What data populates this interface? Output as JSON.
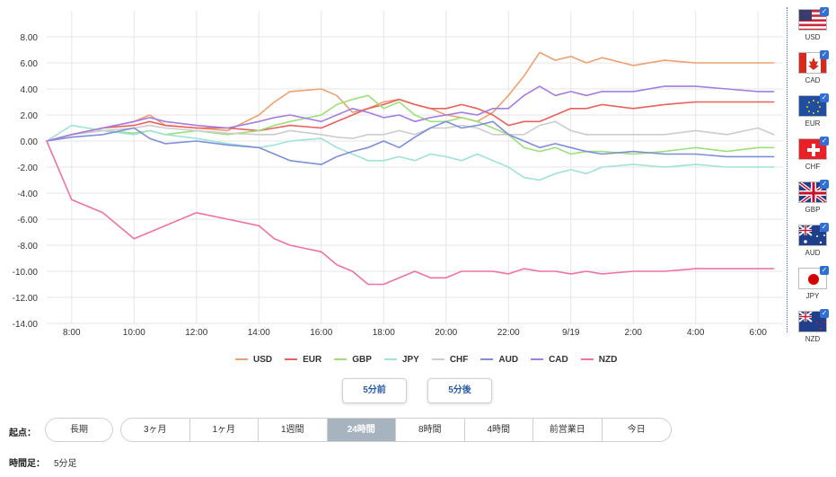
{
  "chart_data": {
    "type": "line",
    "ylim": [
      -14,
      10
    ],
    "yticks": [
      "8.00",
      "6.00",
      "4.00",
      "2.00",
      "0.00",
      "-2.00",
      "-4.00",
      "-6.00",
      "-8.00",
      "-10.00",
      "-12.00",
      "-14.00"
    ],
    "xticks": [
      "8:00",
      "10:00",
      "12:00",
      "14:00",
      "16:00",
      "18:00",
      "20:00",
      "22:00",
      "9/19",
      "2:00",
      "4:00",
      "6:00"
    ],
    "x_hours": [
      7.2,
      8,
      9,
      10,
      10.5,
      11,
      12,
      13,
      14,
      14.5,
      15,
      16,
      16.5,
      17,
      17.5,
      18,
      18.5,
      19,
      19.5,
      20,
      20.5,
      21,
      21.5,
      22,
      22.5,
      23,
      23.5,
      24,
      24.5,
      25,
      26,
      27,
      28,
      29,
      30,
      30.5
    ],
    "series": [
      {
        "name": "USD",
        "color": "#f0a070",
        "values": [
          0.0,
          0.5,
          1.0,
          1.5,
          2.0,
          1.2,
          1.0,
          0.8,
          2.0,
          3.0,
          3.8,
          4.0,
          3.5,
          2.2,
          2.5,
          3.0,
          3.2,
          2.8,
          2.5,
          2.0,
          1.8,
          1.5,
          2.2,
          3.5,
          5.0,
          6.8,
          6.2,
          6.5,
          6.0,
          6.4,
          5.8,
          6.2,
          6.0,
          6.0,
          6.0,
          6.0
        ]
      },
      {
        "name": "EUR",
        "color": "#e8615a",
        "values": [
          0.0,
          0.5,
          1.0,
          1.2,
          1.5,
          1.2,
          1.0,
          1.0,
          0.8,
          1.0,
          1.2,
          1.0,
          1.5,
          2.0,
          2.5,
          2.8,
          3.2,
          2.8,
          2.5,
          2.5,
          2.8,
          2.5,
          2.0,
          1.2,
          1.5,
          1.5,
          2.0,
          2.5,
          2.5,
          2.8,
          2.5,
          2.8,
          3.0,
          3.0,
          3.0,
          3.0
        ]
      },
      {
        "name": "GBP",
        "color": "#9be07a",
        "values": [
          0.0,
          0.5,
          0.8,
          0.6,
          0.8,
          0.5,
          0.8,
          0.5,
          0.8,
          1.2,
          1.5,
          2.0,
          2.8,
          3.2,
          3.5,
          2.5,
          3.0,
          2.0,
          1.5,
          1.5,
          1.8,
          1.5,
          1.0,
          0.5,
          -0.5,
          -0.8,
          -0.5,
          -1.0,
          -0.8,
          -0.8,
          -1.0,
          -0.8,
          -0.5,
          -0.8,
          -0.5,
          -0.5
        ]
      },
      {
        "name": "JPY",
        "color": "#9ee3d6",
        "values": [
          0.0,
          1.2,
          0.8,
          0.5,
          0.8,
          0.5,
          0.2,
          -0.2,
          -0.5,
          -0.3,
          0.0,
          0.2,
          -0.5,
          -1.0,
          -1.5,
          -1.5,
          -1.2,
          -1.5,
          -1.0,
          -1.2,
          -1.5,
          -1.0,
          -1.5,
          -2.0,
          -2.8,
          -3.0,
          -2.5,
          -2.2,
          -2.5,
          -2.0,
          -1.8,
          -2.0,
          -1.8,
          -2.0,
          -2.0,
          -2.0
        ]
      },
      {
        "name": "CHF",
        "color": "#cccccc",
        "values": [
          0.0,
          0.5,
          0.8,
          1.0,
          1.2,
          1.0,
          0.8,
          0.6,
          0.5,
          0.5,
          0.8,
          0.5,
          0.3,
          0.2,
          0.5,
          0.5,
          0.8,
          0.5,
          1.0,
          1.0,
          1.2,
          1.0,
          0.5,
          0.5,
          0.5,
          1.2,
          1.5,
          0.8,
          0.5,
          0.5,
          0.5,
          0.5,
          0.8,
          0.5,
          1.0,
          0.5
        ]
      },
      {
        "name": "AUD",
        "color": "#7f8ed9",
        "values": [
          0.0,
          0.3,
          0.5,
          1.0,
          0.2,
          -0.2,
          0.0,
          -0.3,
          -0.5,
          -1.0,
          -1.5,
          -1.8,
          -1.2,
          -0.8,
          -0.5,
          0.0,
          -0.5,
          0.3,
          1.0,
          1.5,
          1.0,
          1.2,
          1.5,
          0.5,
          0.0,
          -0.5,
          -0.2,
          -0.5,
          -0.8,
          -1.0,
          -0.8,
          -1.0,
          -1.0,
          -1.2,
          -1.2,
          -1.2
        ]
      },
      {
        "name": "CAD",
        "color": "#a57ce0",
        "values": [
          0.0,
          0.5,
          1.0,
          1.5,
          1.8,
          1.5,
          1.2,
          1.0,
          1.5,
          1.8,
          2.0,
          1.5,
          2.0,
          2.5,
          2.2,
          1.8,
          2.0,
          1.5,
          1.8,
          2.0,
          2.2,
          2.0,
          2.5,
          2.5,
          3.5,
          4.2,
          3.5,
          3.8,
          3.5,
          3.8,
          3.8,
          4.2,
          4.2,
          4.0,
          3.8,
          3.8
        ]
      },
      {
        "name": "NZD",
        "color": "#ee72a5",
        "values": [
          0.0,
          -4.5,
          -5.5,
          -7.5,
          -7.0,
          -6.5,
          -5.5,
          -6.0,
          -6.5,
          -7.5,
          -8.0,
          -8.5,
          -9.5,
          -10.0,
          -11.0,
          -11.0,
          -10.5,
          -10.0,
          -10.5,
          -10.5,
          -10.0,
          -10.0,
          -10.0,
          -10.2,
          -9.8,
          -10.0,
          -10.0,
          -10.2,
          -10.0,
          -10.2,
          -10.0,
          -10.0,
          -9.8,
          -9.8,
          -9.8,
          -9.8
        ]
      }
    ]
  },
  "currencies": [
    {
      "code": "USD",
      "label": "USD"
    },
    {
      "code": "CAD",
      "label": "CAD"
    },
    {
      "code": "EUR",
      "label": "EUR"
    },
    {
      "code": "CHF",
      "label": "CHF"
    },
    {
      "code": "GBP",
      "label": "GBP"
    },
    {
      "code": "AUD",
      "label": "AUD"
    },
    {
      "code": "JPY",
      "label": "JPY"
    },
    {
      "code": "NZD",
      "label": "NZD"
    }
  ],
  "controls": {
    "prev_label": "5分前",
    "next_label": "5分後",
    "period_label": "起点：",
    "period_long": "長期",
    "periods": [
      "3ヶ月",
      "1ヶ月",
      "1週間",
      "24時間",
      "8時間",
      "4時間",
      "前営業日",
      "今日"
    ],
    "active_period": "24時間",
    "timeframe_label": "時間足：",
    "timeframe_value": "5分足"
  }
}
